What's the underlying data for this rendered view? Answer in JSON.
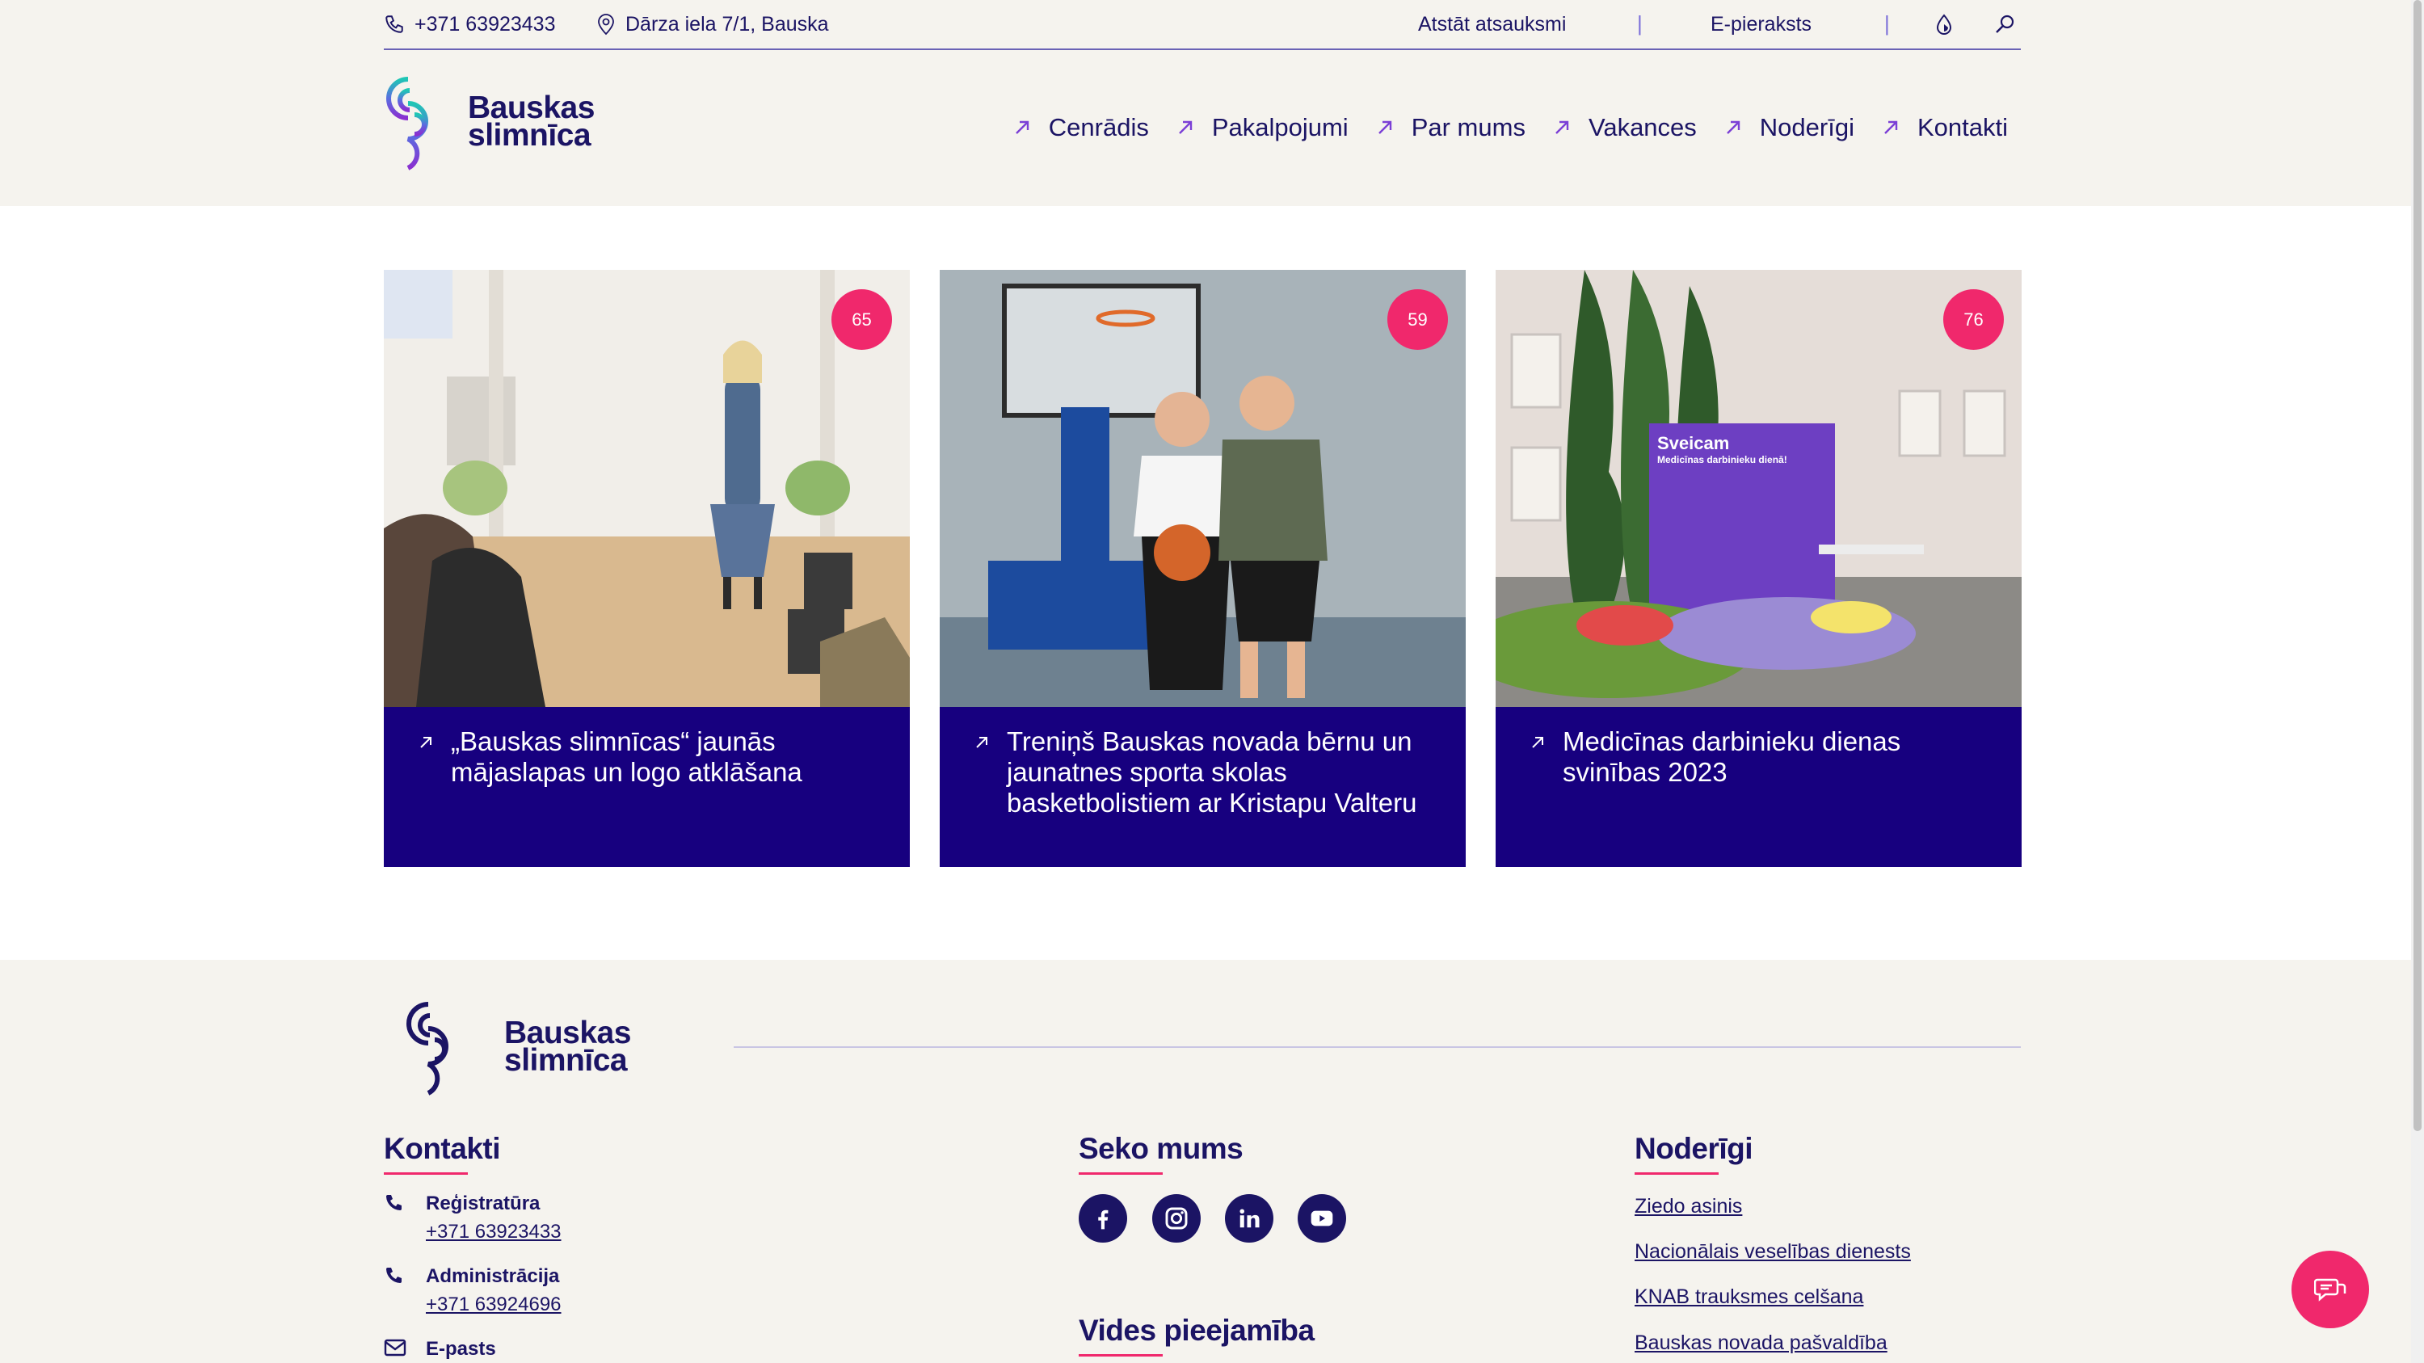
{
  "utility": {
    "phone": "+371 63923433",
    "address": "Dārza iela 7/1, Bauska",
    "feedback": "Atstāt atsauksmi",
    "e_appointment": "E-pieraksts"
  },
  "logo": {
    "line1": "Bauskas",
    "line2": "slimnīca"
  },
  "nav": [
    {
      "label": "Cenrādis"
    },
    {
      "label": "Pakalpojumi"
    },
    {
      "label": "Par mums"
    },
    {
      "label": "Vakances"
    },
    {
      "label": "Noderīgi"
    },
    {
      "label": "Kontakti"
    }
  ],
  "cards": [
    {
      "badge": "65",
      "title": "„Bauskas slimnīcas“ jaunās mājaslapas un logo atklāšana"
    },
    {
      "badge": "59",
      "title": "Treniņš Bauskas novada bērnu un jaunatnes sporta skolas basketbolistiem ar Kristapu Valteru"
    },
    {
      "badge": "76",
      "title": "Medicīnas darbinieku dienas svinības 2023",
      "image_text_1": "Sveicam",
      "image_text_2": "Medicīnas darbinieku dienā!"
    }
  ],
  "footer": {
    "logo_line1": "Bauskas",
    "logo_line2": "slimnīca",
    "contacts_heading": "Kontakti",
    "contacts": [
      {
        "label": "Reģistratūra",
        "value": "+371 63923433",
        "icon": "phone-icon"
      },
      {
        "label": "Administrācija",
        "value": "+371 63924696",
        "icon": "phone-icon"
      },
      {
        "label": "E-pasts",
        "value": "",
        "icon": "mail-icon"
      }
    ],
    "follow_heading": "Seko mums",
    "social": [
      "facebook-icon",
      "instagram-icon",
      "linkedin-icon",
      "youtube-icon"
    ],
    "accessibility_heading": "Vides pieejamība",
    "useful_heading": "Noderīgi",
    "useful_links": [
      "Ziedo asinis",
      "Nacionālais veselības dienests",
      "KNAB trauksmes celšana",
      "Bauskas novada pašvaldība"
    ]
  },
  "colors": {
    "navy": "#17007f",
    "text": "#1b1464",
    "accent": "#f0286c",
    "beige": "#f5f3ee"
  }
}
